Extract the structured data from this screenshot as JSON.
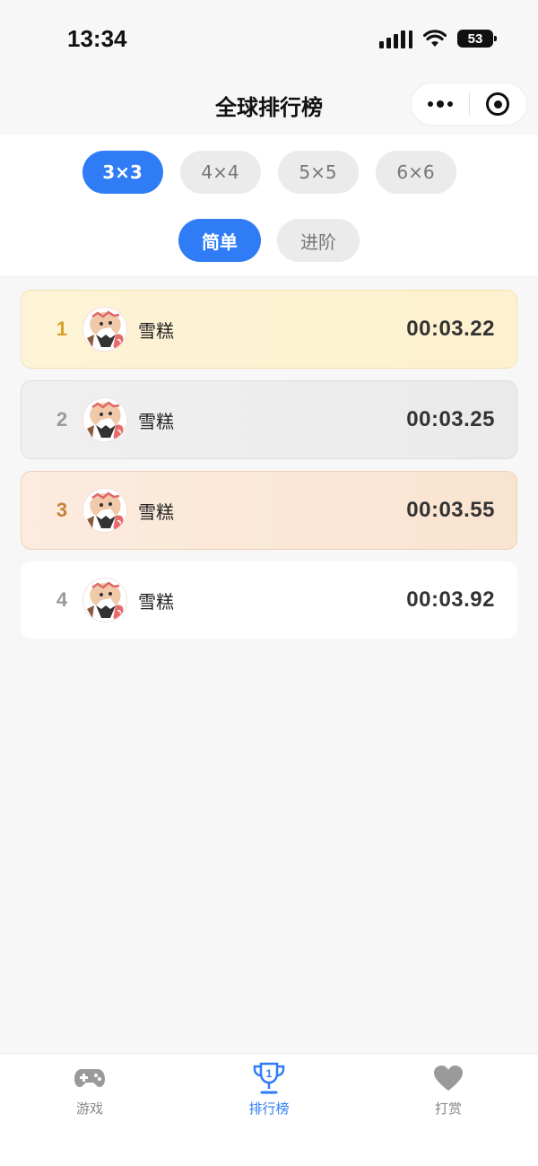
{
  "status_bar": {
    "time": "13:34",
    "battery": "53"
  },
  "header": {
    "title": "全球排行榜"
  },
  "filters": {
    "sizes": [
      "3×3",
      "4×4",
      "5×5",
      "6×6"
    ],
    "selected_size": "3×3",
    "modes": [
      "简单",
      "进阶"
    ],
    "selected_mode": "简单"
  },
  "ranking": [
    {
      "rank": "1",
      "name": "雪糕",
      "time": "00:03.22"
    },
    {
      "rank": "2",
      "name": "雪糕",
      "time": "00:03.25"
    },
    {
      "rank": "3",
      "name": "雪糕",
      "time": "00:03.55"
    },
    {
      "rank": "4",
      "name": "雪糕",
      "time": "00:03.92"
    }
  ],
  "tab_bar": {
    "items": [
      {
        "label": "游戏",
        "icon": "gamepad-icon"
      },
      {
        "label": "排行榜",
        "icon": "trophy-icon"
      },
      {
        "label": "打赏",
        "icon": "heart-icon"
      }
    ],
    "active_index": 1
  },
  "colors": {
    "accent": "#2f7cf6",
    "gold_rank": "#d4a32a",
    "silver_rank": "#999999",
    "bronze_rank": "#c97f3a",
    "plain_rank": "#999999"
  }
}
